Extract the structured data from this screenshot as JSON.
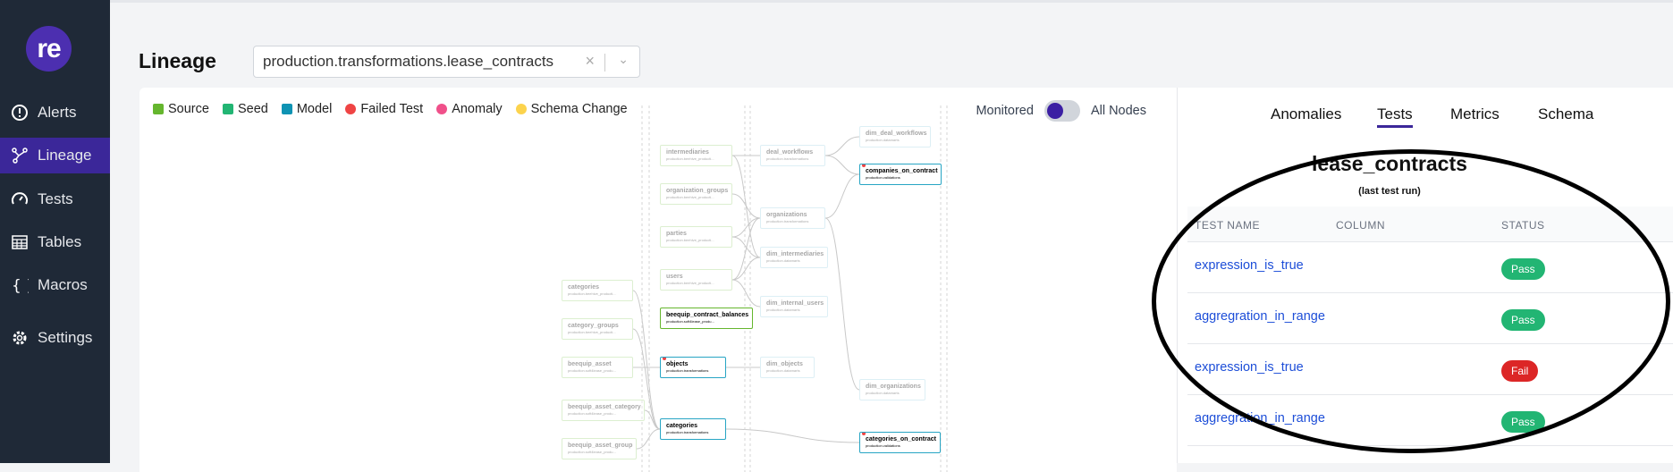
{
  "sidebar": {
    "logo": "re",
    "items": [
      {
        "label": "Alerts",
        "icon": "alert-circle-icon"
      },
      {
        "label": "Lineage",
        "icon": "lineage-icon",
        "active": true
      },
      {
        "label": "Tests",
        "icon": "gauge-icon"
      },
      {
        "label": "Tables",
        "icon": "table-icon"
      },
      {
        "label": "Macros",
        "icon": "braces-icon"
      },
      {
        "label": "Settings",
        "icon": "gear-icon"
      }
    ]
  },
  "header": {
    "title": "Lineage",
    "select_value": "production.transformations.lease_contracts",
    "clear": "×",
    "chevron": "⌄"
  },
  "legend": [
    {
      "label": "Source",
      "color": "#65b62e"
    },
    {
      "label": "Seed",
      "color": "#22b573"
    },
    {
      "label": "Model",
      "color": "#0e93b3"
    },
    {
      "label": "Failed Test",
      "color": "#ef4444"
    },
    {
      "label": "Anomaly",
      "color": "#f0508a"
    },
    {
      "label": "Schema Change",
      "color": "#fcd34d"
    }
  ],
  "toggle": {
    "left": "Monitored",
    "right": "All Nodes",
    "state": "monitored"
  },
  "graph": {
    "nodes": [
      {
        "name": "intermediaries",
        "sub": "production.beehive_producti...",
        "type": "source",
        "faded": true
      },
      {
        "name": "organization_groups",
        "sub": "production.beehive_producti...",
        "type": "source",
        "faded": true
      },
      {
        "name": "parties",
        "sub": "production.beehive_producti...",
        "type": "source",
        "faded": true
      },
      {
        "name": "users",
        "sub": "production.beehive_producti...",
        "type": "source",
        "faded": true
      },
      {
        "name": "beequip_contract_balances",
        "sub": "production.soft4lease_produ...",
        "type": "source",
        "faded": false
      },
      {
        "name": "objects",
        "sub": "production.transformations",
        "type": "model",
        "faded": false,
        "failed": true
      },
      {
        "name": "categories",
        "sub": "production.transformations",
        "type": "model",
        "faded": false
      },
      {
        "name": "categories",
        "sub": "production.beehive_producti...",
        "type": "source",
        "faded": true
      },
      {
        "name": "category_groups",
        "sub": "production.beehive_producti...",
        "type": "source",
        "faded": true
      },
      {
        "name": "beequip_asset",
        "sub": "production.soft4lease_produ...",
        "type": "source",
        "faded": true
      },
      {
        "name": "beequip_asset_category",
        "sub": "production.soft4lease_produ...",
        "type": "source",
        "faded": true
      },
      {
        "name": "beequip_asset_group",
        "sub": "production.soft4lease_produ...",
        "type": "source",
        "faded": true
      },
      {
        "name": "deal_workflows",
        "sub": "production.transformations",
        "type": "model",
        "faded": true
      },
      {
        "name": "organizations",
        "sub": "production.transformations",
        "type": "model",
        "faded": true
      },
      {
        "name": "dim_intermediaries",
        "sub": "production.datamarts",
        "type": "model",
        "faded": true
      },
      {
        "name": "dim_internal_users",
        "sub": "production.datamarts",
        "type": "model",
        "faded": true
      },
      {
        "name": "dim_objects",
        "sub": "production.datamarts",
        "type": "model",
        "faded": true
      },
      {
        "name": "dim_deal_workflows",
        "sub": "production.datamarts",
        "type": "model",
        "faded": true
      },
      {
        "name": "companies_on_contract",
        "sub": "production.validations",
        "type": "model",
        "faded": false,
        "failed": true
      },
      {
        "name": "dim_organizations",
        "sub": "production.datamarts",
        "type": "model",
        "faded": true
      },
      {
        "name": "categories_on_contract",
        "sub": "production.validations",
        "type": "model",
        "faded": false,
        "failed": true
      }
    ],
    "edges": [
      [
        0,
        12
      ],
      [
        0,
        14
      ],
      [
        1,
        13
      ],
      [
        2,
        13
      ],
      [
        2,
        14
      ],
      [
        3,
        14
      ],
      [
        3,
        15
      ],
      [
        3,
        13
      ],
      [
        5,
        16
      ],
      [
        9,
        5
      ],
      [
        7,
        6
      ],
      [
        8,
        6
      ],
      [
        10,
        6
      ],
      [
        11,
        6
      ],
      [
        6,
        20
      ],
      [
        12,
        17
      ],
      [
        12,
        18
      ],
      [
        13,
        18
      ],
      [
        13,
        19
      ]
    ]
  },
  "panel": {
    "tabs": [
      {
        "label": "Anomalies"
      },
      {
        "label": "Tests",
        "active": true
      },
      {
        "label": "Metrics"
      },
      {
        "label": "Schema"
      }
    ],
    "title": "lease_contracts",
    "subtitle": "(last test run)",
    "columns": [
      "TEST NAME",
      "COLUMN",
      "STATUS"
    ],
    "rows": [
      {
        "test": "expression_is_true",
        "column": "",
        "status": "Pass"
      },
      {
        "test": "aggregration_in_range",
        "column": "",
        "status": "Pass"
      },
      {
        "test": "expression_is_true",
        "column": "",
        "status": "Fail"
      },
      {
        "test": "aggregration_in_range",
        "column": "",
        "status": "Pass"
      }
    ],
    "status_colors": {
      "Pass": "#22b573",
      "Fail": "#dc2626"
    }
  }
}
